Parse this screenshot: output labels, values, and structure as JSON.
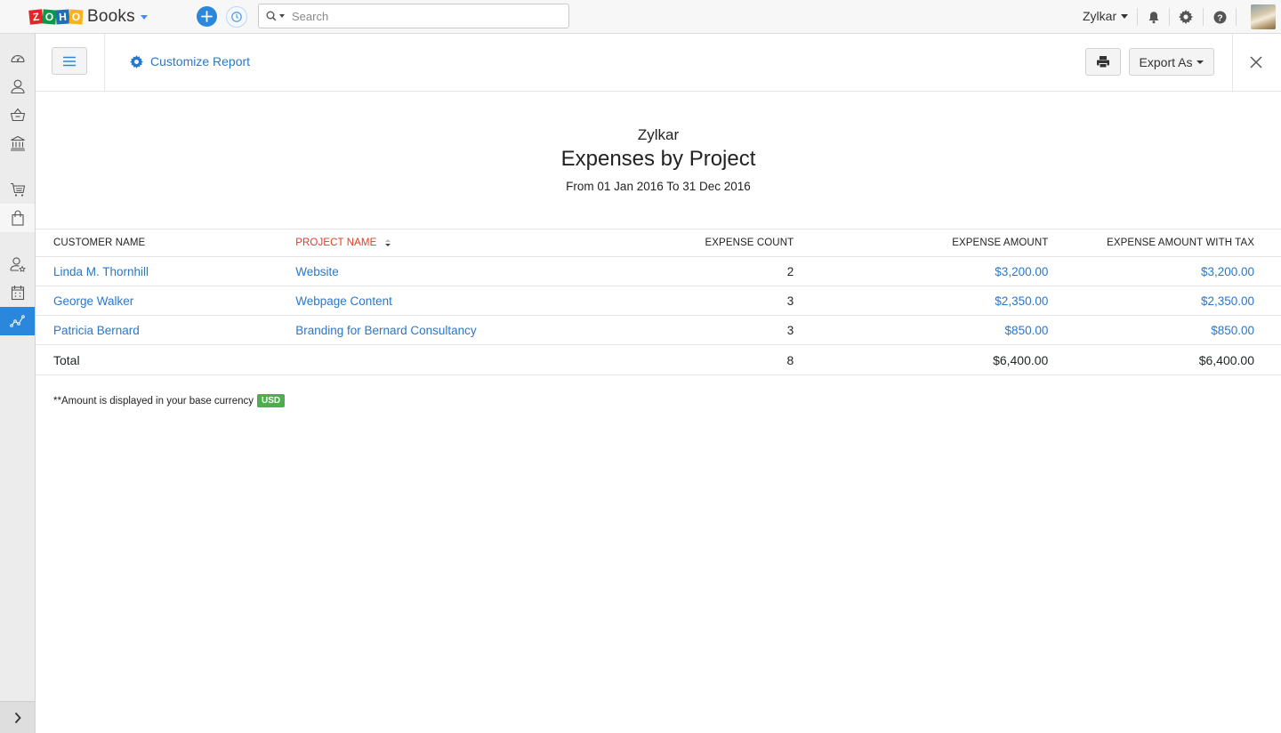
{
  "topbar": {
    "logo_letters": [
      "Z",
      "O",
      "H",
      "O"
    ],
    "brand": "Books",
    "search_placeholder": "Search",
    "search_value": "",
    "org_name": "Zylkar",
    "icons": [
      "plus-icon",
      "recent-activity-icon",
      "search-icon",
      "bell-icon",
      "gear-icon",
      "help-icon"
    ]
  },
  "sidebar": {
    "items": [
      {
        "name": "dashboard",
        "icon": "dashboard-icon",
        "active": false
      },
      {
        "name": "contacts",
        "icon": "contacts-icon",
        "active": false
      },
      {
        "name": "items",
        "icon": "basket-icon",
        "active": false
      },
      {
        "name": "banking",
        "icon": "bank-icon",
        "active": false
      },
      {
        "name": "sales",
        "icon": "cart-icon",
        "active": false
      },
      {
        "name": "purchases",
        "icon": "shopping-bag-icon",
        "active": false
      },
      {
        "name": "time-tracking",
        "icon": "user-star-icon",
        "active": false
      },
      {
        "name": "calendar",
        "icon": "calendar-icon",
        "active": false
      },
      {
        "name": "reports",
        "icon": "reports-chart-icon",
        "active": true
      }
    ],
    "toggle_icon": "chevron-right-icon"
  },
  "report_header": {
    "customize_label": "Customize Report",
    "export_label": "Export As"
  },
  "report": {
    "org_name": "Zylkar",
    "title": "Expenses by Project",
    "date_range": "From 01 Jan 2016 To 31 Dec 2016",
    "columns": [
      "Customer Name",
      "Project Name",
      "Expense Count",
      "Expense Amount",
      "Expense Amount With Tax"
    ],
    "sorted_column": "Project Name",
    "rows": [
      {
        "customer": "Linda M. Thornhill",
        "project": "Website",
        "count": "2",
        "amount": "$3,200.00",
        "amount_tax": "$3,200.00"
      },
      {
        "customer": "George Walker",
        "project": "Webpage Content",
        "count": "3",
        "amount": "$2,350.00",
        "amount_tax": "$2,350.00"
      },
      {
        "customer": "Patricia Bernard",
        "project": "Branding for Bernard Consultancy",
        "count": "3",
        "amount": "$850.00",
        "amount_tax": "$850.00"
      }
    ],
    "total": {
      "label": "Total",
      "count": "8",
      "amount": "$6,400.00",
      "amount_tax": "$6,400.00"
    },
    "footnote": "**Amount is displayed in your base currency",
    "currency_badge": "USD"
  },
  "colors": {
    "accent": "#2a87db",
    "link": "#2a77c9",
    "sorted_header": "#e03b24",
    "currency_badge": "#4cae4c"
  }
}
